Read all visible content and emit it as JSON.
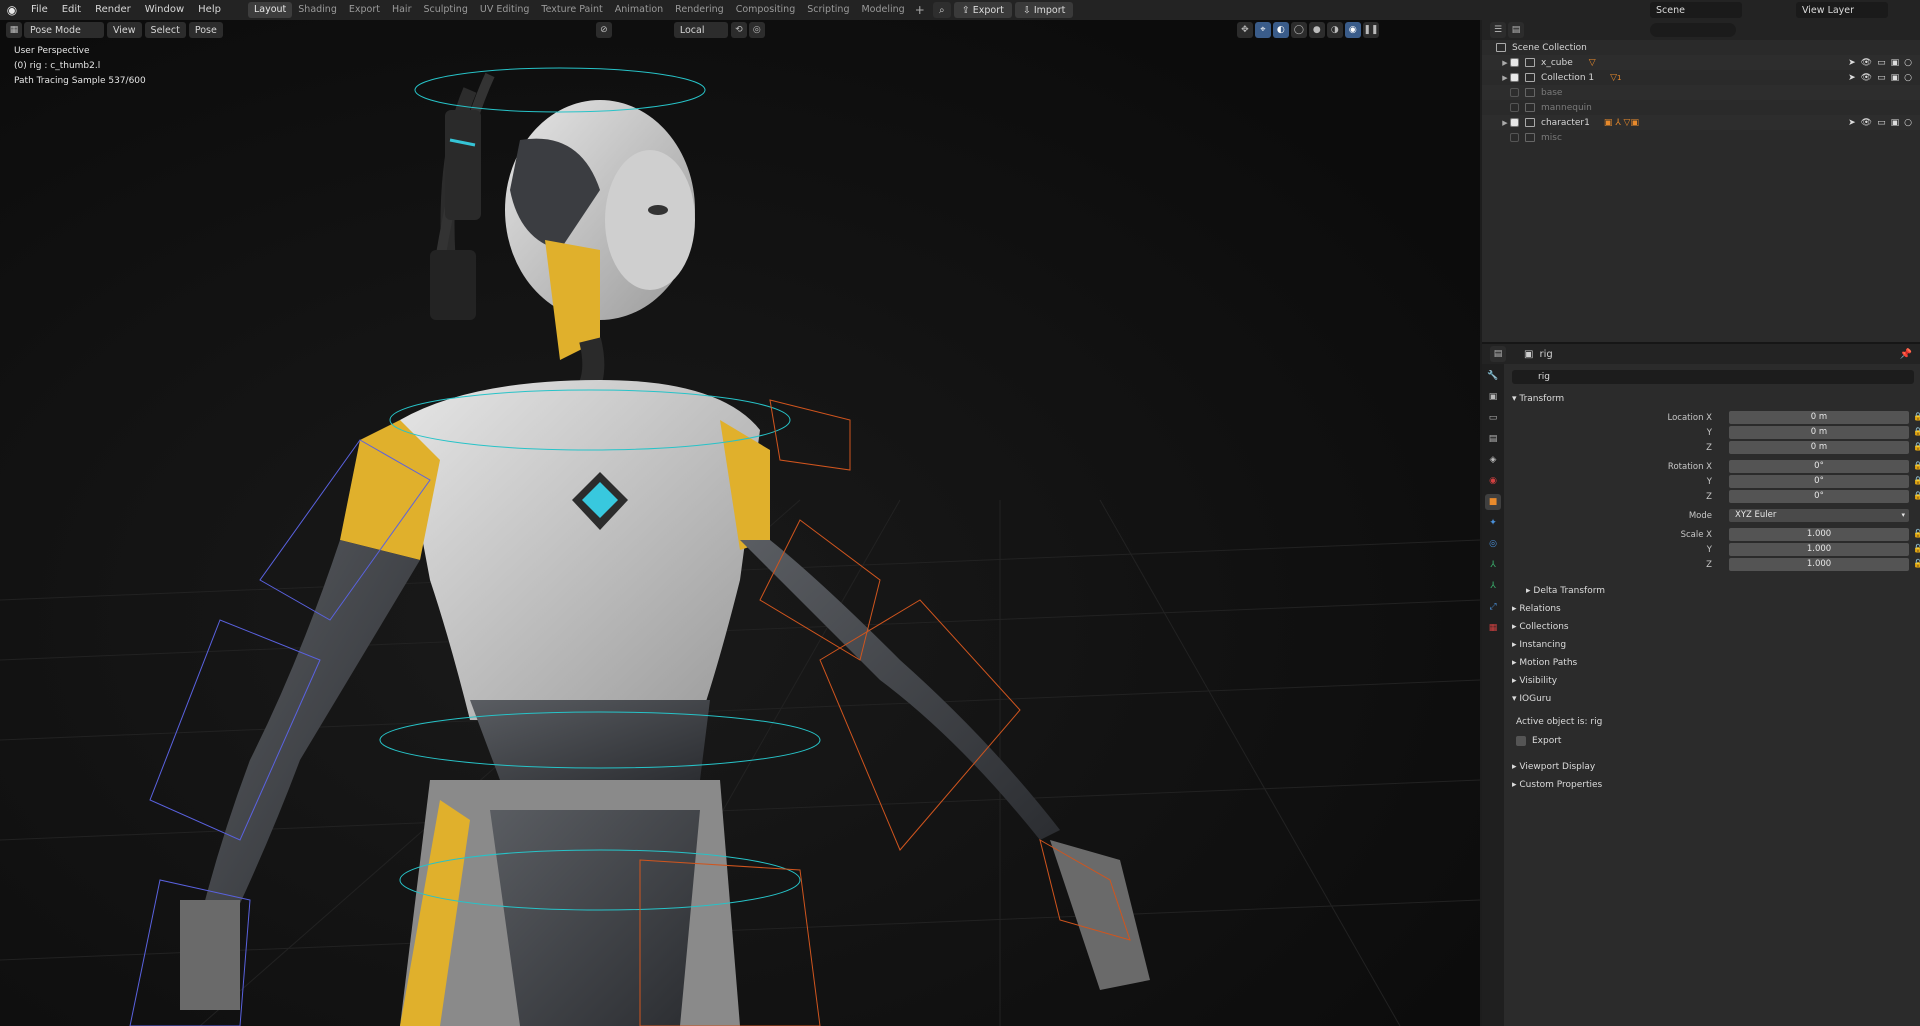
{
  "topbar": {
    "menu": [
      "File",
      "Edit",
      "Render",
      "Window",
      "Help"
    ],
    "workspaces": [
      "Layout",
      "Shading",
      "Export",
      "Hair",
      "Sculpting",
      "UV Editing",
      "Texture Paint",
      "Animation",
      "Rendering",
      "Compositing",
      "Scripting",
      "Modeling"
    ],
    "active_workspace": "Layout",
    "export_label": "Export",
    "import_label": "Import",
    "scene": "Scene",
    "view_layer": "View Layer"
  },
  "viewport": {
    "mode": "Pose Mode",
    "menus": [
      "View",
      "Select",
      "Pose"
    ],
    "orientation": "Local",
    "overlay_lines": [
      "User Perspective",
      "(0) rig : c_thumb2.l",
      "Path Tracing Sample 537/600"
    ]
  },
  "outliner": {
    "root": "Scene Collection",
    "search_placeholder": "",
    "rows": [
      {
        "name": "x_cube",
        "checked": true,
        "expandable": true,
        "dim": false
      },
      {
        "name": "Collection 1",
        "checked": true,
        "expandable": true,
        "dim": false,
        "badge": "1"
      },
      {
        "name": "base",
        "checked": false,
        "expandable": false,
        "dim": true
      },
      {
        "name": "mannequin",
        "checked": false,
        "expandable": false,
        "dim": true
      },
      {
        "name": "character1",
        "checked": true,
        "expandable": true,
        "dim": false
      },
      {
        "name": "misc",
        "checked": false,
        "expandable": false,
        "dim": true
      }
    ]
  },
  "properties": {
    "header_object": "rig",
    "object_name": "rig",
    "transform_title": "Transform",
    "location_label": "Location X",
    "rotation_label": "Rotation X",
    "scale_label": "Scale X",
    "axis_y": "Y",
    "axis_z": "Z",
    "location": [
      "0 m",
      "0 m",
      "0 m"
    ],
    "rotation": [
      "0°",
      "0°",
      "0°"
    ],
    "mode_label": "Mode",
    "mode_value": "XYZ Euler",
    "scale": [
      "1.000",
      "1.000",
      "1.000"
    ],
    "delta_transform": "Delta Transform",
    "sections": [
      "Relations",
      "Collections",
      "Instancing",
      "Motion Paths",
      "Visibility"
    ],
    "ioguru_title": "IOGuru",
    "active_object_text": "Active object is: rig",
    "export_checkbox": "Export",
    "after_sections": [
      "Viewport Display",
      "Custom Properties"
    ]
  }
}
